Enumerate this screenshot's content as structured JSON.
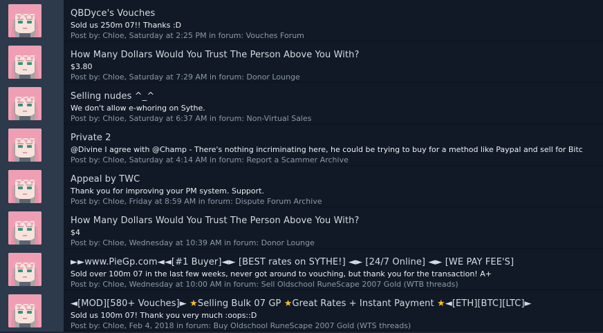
{
  "posts": [
    {
      "title": "QBDyce's Vouches",
      "snippet": "Sold us 250m 07!! Thanks :D",
      "meta_prefix": "Post by: ",
      "author": "Chloe",
      "time": "Saturday at 2:25 PM",
      "meta_mid": " in forum: ",
      "forum": "Vouches Forum"
    },
    {
      "title": "How Many Dollars Would You Trust The Person Above You With?",
      "snippet": "$3.80",
      "meta_prefix": "Post by: ",
      "author": "Chloe",
      "time": "Saturday at 7:29 AM",
      "meta_mid": " in forum: ",
      "forum": "Donor Lounge"
    },
    {
      "title": "Selling nudes ^_^",
      "snippet": "We don't allow e-whoring on Sythe.",
      "meta_prefix": "Post by: ",
      "author": "Chloe",
      "time": "Saturday at 6:37 AM",
      "meta_mid": " in forum: ",
      "forum": "Non-Virtual Sales"
    },
    {
      "title": "Private 2",
      "snippet": "@Divine I agree with @Champ - There's nothing incriminating here, he could be trying to buy for a method like Paypal and sell for Bitc",
      "meta_prefix": "Post by: ",
      "author": "Chloe",
      "time": "Saturday at 4:14 AM",
      "meta_mid": " in forum: ",
      "forum": "Report a Scammer Archive"
    },
    {
      "title": "Appeal by TWC",
      "snippet": "Thank you for improving your PM system. Support.",
      "meta_prefix": "Post by: ",
      "author": "Chloe",
      "time": "Friday at 8:59 AM",
      "meta_mid": " in forum: ",
      "forum": "Dispute Forum Archive"
    },
    {
      "title": "How Many Dollars Would You Trust The Person Above You With?",
      "snippet": "$4",
      "meta_prefix": "Post by: ",
      "author": "Chloe",
      "time": "Wednesday at 10:39 AM",
      "meta_mid": " in forum: ",
      "forum": "Donor Lounge"
    },
    {
      "title": "►►www.PieGp.com◄◄[#1 Buyer]◄► [BEST rates on SYTHE!] ◄► [24/7 Online] ◄► [WE PAY FEE'S]",
      "snippet": "Sold over 100m 07 in the last few weeks, never got around to vouching, but thank you for the transaction! A+",
      "meta_prefix": "Post by: ",
      "author": "Chloe",
      "time": "Wednesday at 10:00 AM",
      "meta_mid": " in forum: ",
      "forum": "Sell Oldschool RuneScape 2007 Gold (WTB threads)"
    },
    {
      "title": "◄[MOD][580+ Vouches]► ⭐Selling Bulk 07 GP ⭐Great Rates + Instant Payment ⭐◄[ETH][BTC][LTC]►",
      "snippet": "Sold us 100m 07! Thank you very much :oops::D",
      "meta_prefix": "Post by: ",
      "author": "Chloe",
      "time": "Feb 4, 2018",
      "meta_mid": " in forum: ",
      "forum": "Buy Oldschool RuneScape 2007 Gold (WTS threads)"
    }
  ],
  "avatar_icon": "anime-girl-avatar",
  "colors": {
    "page_bg": "#1b2533",
    "avatar_column": "#2c3a4b",
    "row_bg": "#101925",
    "title": "#d5dbe2",
    "snippet": "#eef2f6",
    "meta": "#8e9aa8",
    "star": "#f6c02a"
  }
}
